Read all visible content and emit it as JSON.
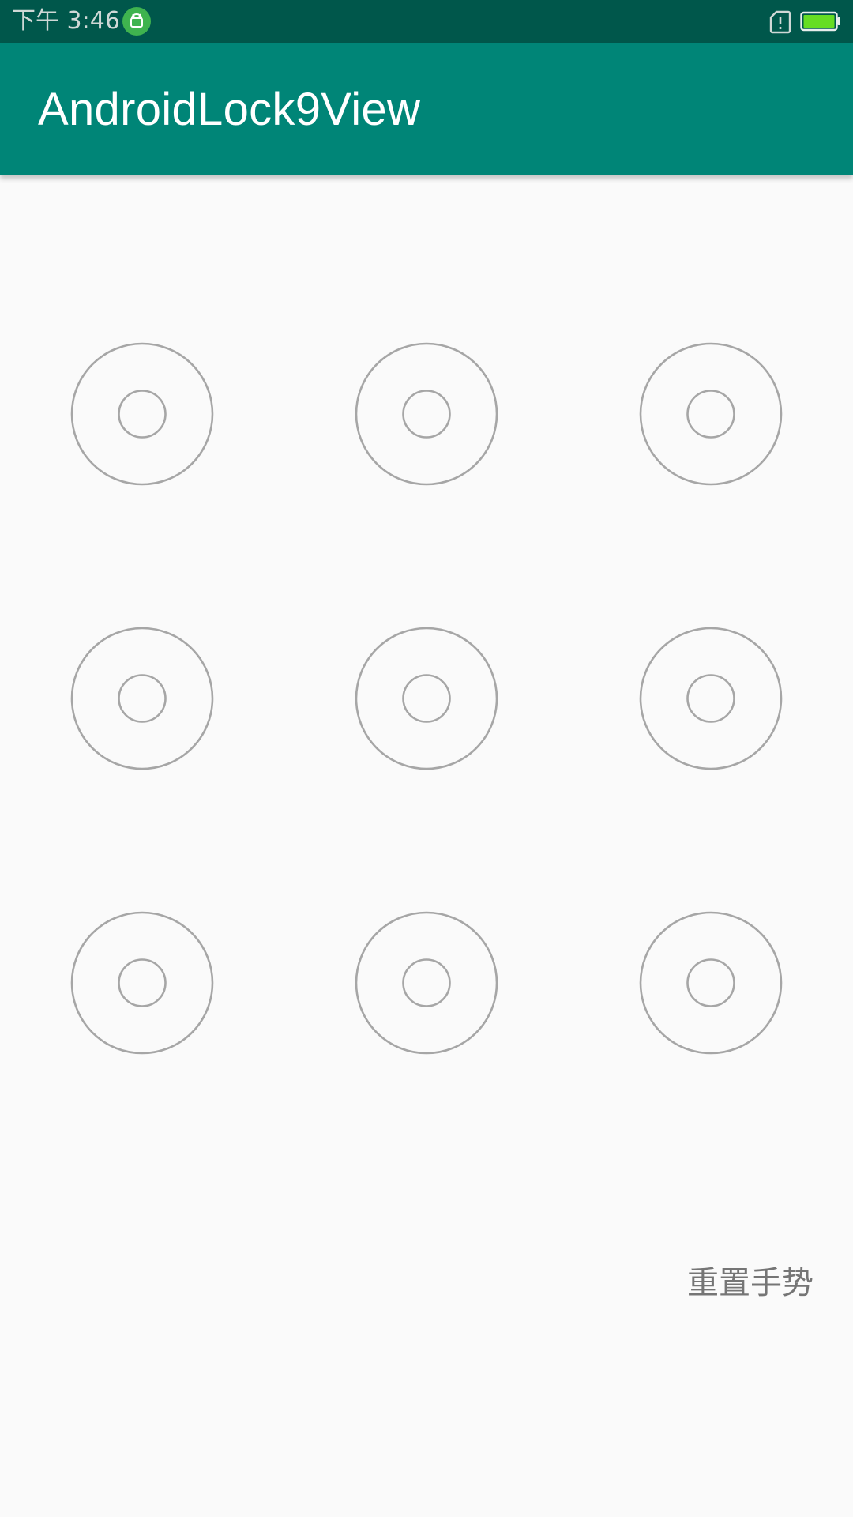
{
  "status_bar": {
    "time": "下午 3:46",
    "icons": [
      "android-debug-icon",
      "sim-alert-icon",
      "battery-icon"
    ],
    "battery_color": "#66dd22"
  },
  "app_bar": {
    "title": "AndroidLock9View",
    "color": "#008577"
  },
  "lock_grid": {
    "rows": 3,
    "cols": 3,
    "nodes": [
      {
        "id": 1,
        "selected": false
      },
      {
        "id": 2,
        "selected": false
      },
      {
        "id": 3,
        "selected": false
      },
      {
        "id": 4,
        "selected": false
      },
      {
        "id": 5,
        "selected": false
      },
      {
        "id": 6,
        "selected": false
      },
      {
        "id": 7,
        "selected": false
      },
      {
        "id": 8,
        "selected": false
      },
      {
        "id": 9,
        "selected": false
      }
    ],
    "node_color": "#a6a6a6"
  },
  "reset_button": {
    "label": "重置手势"
  }
}
